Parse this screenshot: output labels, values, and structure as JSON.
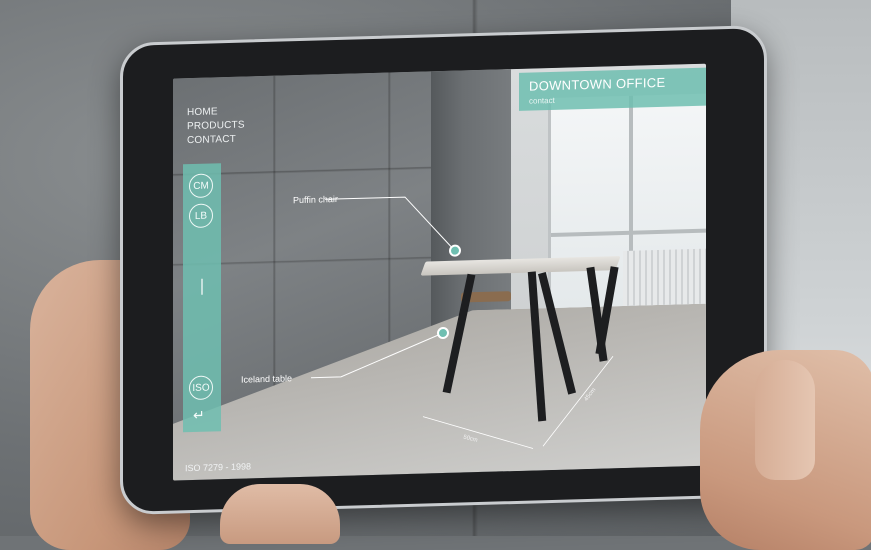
{
  "nav": {
    "items": [
      "HOME",
      "PRODUCTS",
      "CONTACT"
    ]
  },
  "banner": {
    "title": "DOWNTOWN OFFICE",
    "subtitle": "contact"
  },
  "sidebar": {
    "unit_cm": "CM",
    "unit_lb": "LB",
    "iso_label": "ISO",
    "back_icon": "return-arrow-icon",
    "back_glyph": "↵"
  },
  "annotations": {
    "chair_label": "Puffin chair",
    "table_label": "Iceland table"
  },
  "dimensions": {
    "width_label": "50cm",
    "depth_label": "45cm"
  },
  "footer": {
    "standard": "ISO 7279 - 1998"
  },
  "colors": {
    "accent": "#6ebeb0",
    "text": "#ffffff"
  }
}
